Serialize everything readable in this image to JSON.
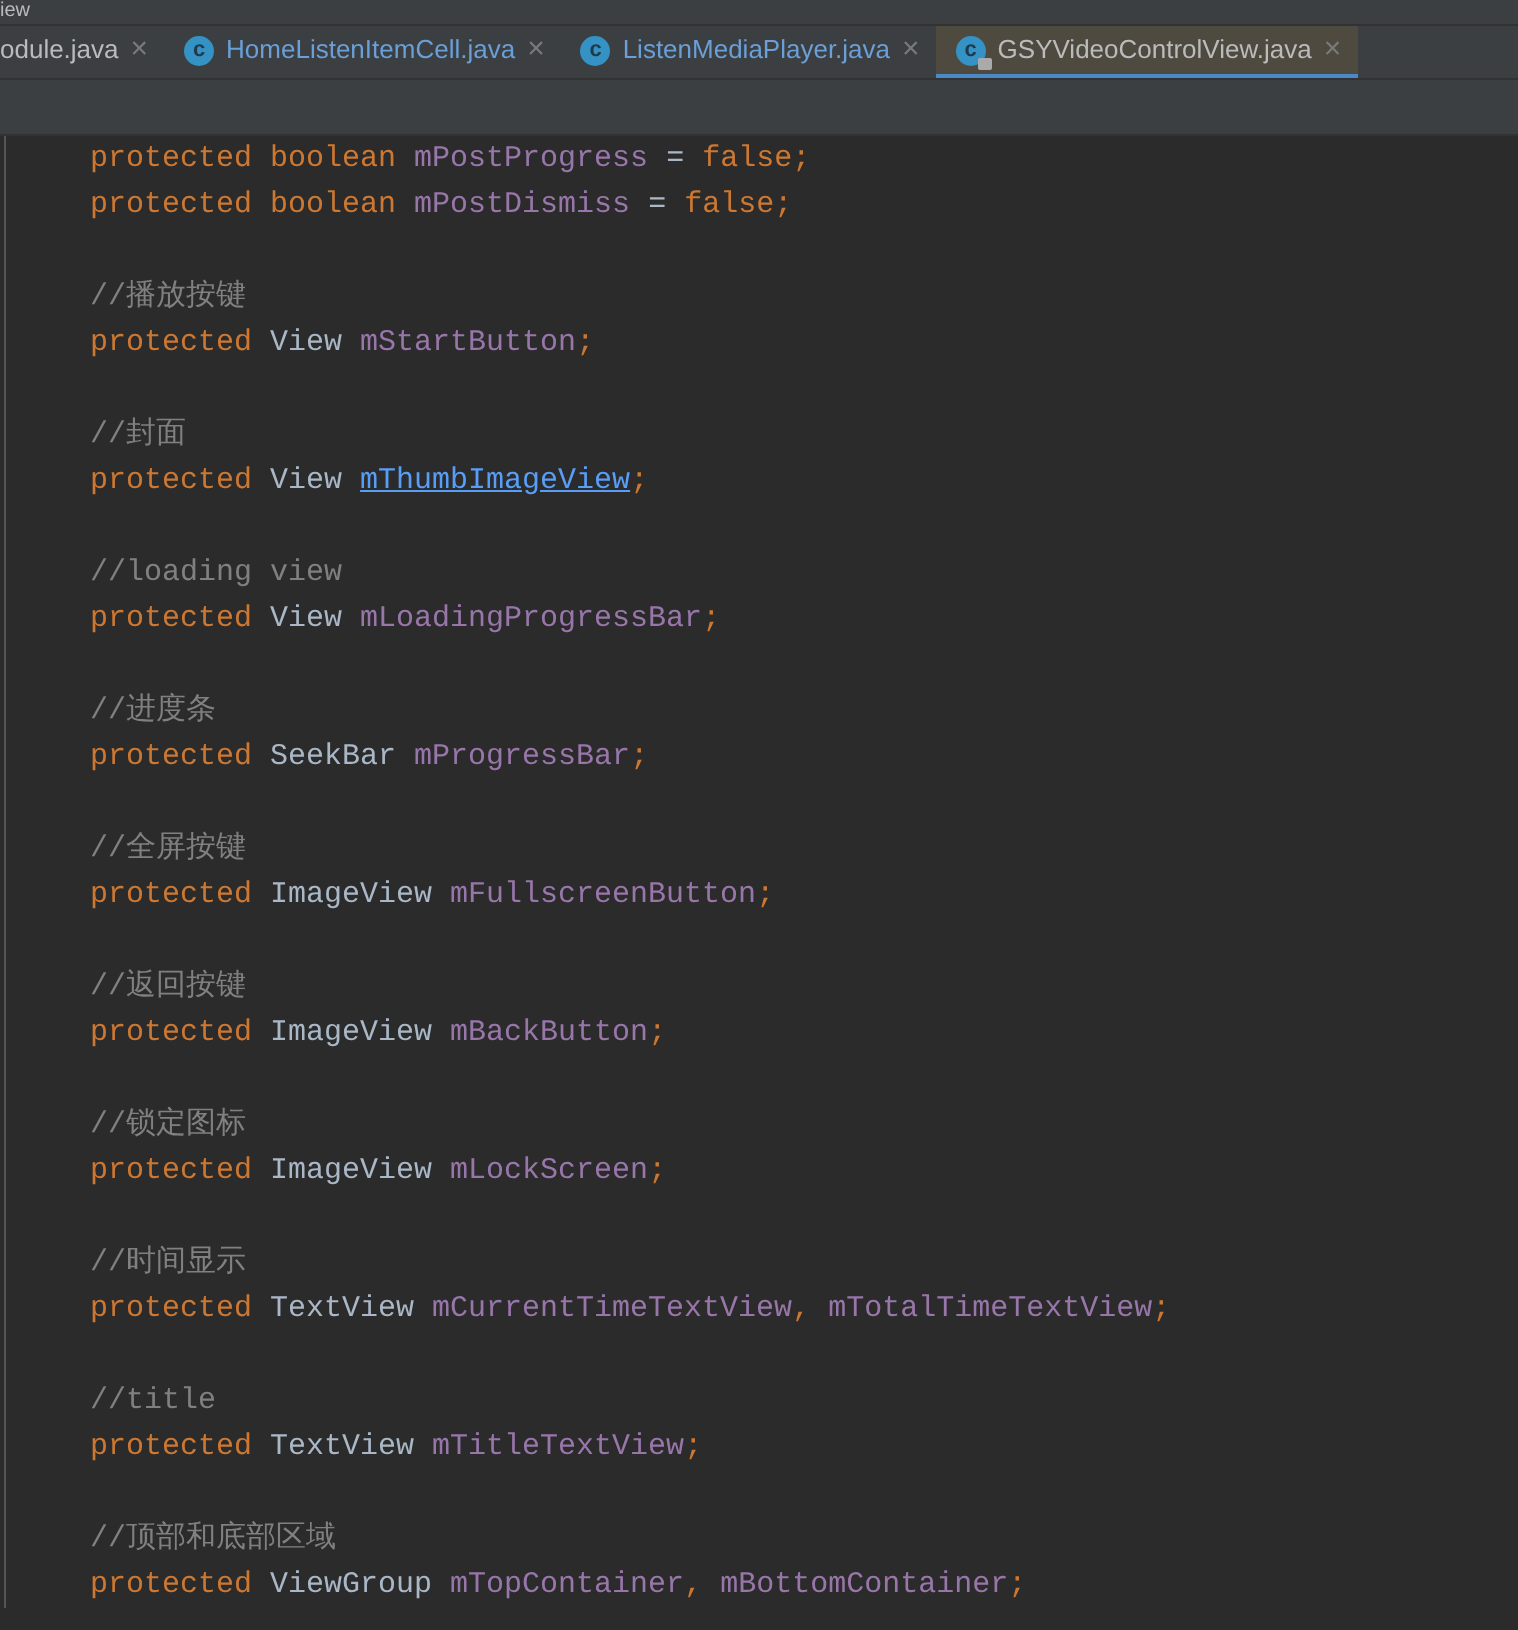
{
  "menu_fragment": "iew",
  "tabs": [
    {
      "label": "odule.java",
      "selected": false,
      "modified": false
    },
    {
      "label": "HomeListenItemCell.java",
      "selected": false,
      "modified": true,
      "icon_letter": "c"
    },
    {
      "label": "ListenMediaPlayer.java",
      "selected": false,
      "modified": true,
      "icon_letter": "c"
    },
    {
      "label": "GSYVideoControlView.java",
      "selected": true,
      "modified": false,
      "icon_letter": "c",
      "locked": true
    }
  ],
  "close_symbol": "×",
  "code_lines": [
    {
      "kind": "code",
      "tokens": [
        {
          "kind": "keyword",
          "text": "protected boolean "
        },
        {
          "kind": "field",
          "text": "mPostProgress"
        },
        {
          "kind": "plain",
          "text": " = "
        },
        {
          "kind": "keyword",
          "text": "false;"
        }
      ]
    },
    {
      "kind": "code",
      "tokens": [
        {
          "kind": "keyword",
          "text": "protected boolean "
        },
        {
          "kind": "field",
          "text": "mPostDismiss"
        },
        {
          "kind": "plain",
          "text": " = "
        },
        {
          "kind": "keyword",
          "text": "false;"
        }
      ]
    },
    {
      "kind": "blank"
    },
    {
      "kind": "comment",
      "text": "//播放按键"
    },
    {
      "kind": "code",
      "tokens": [
        {
          "kind": "keyword",
          "text": "protected "
        },
        {
          "kind": "plain",
          "text": "View "
        },
        {
          "kind": "field",
          "text": "mStartButton"
        },
        {
          "kind": "keyword",
          "text": ";"
        }
      ]
    },
    {
      "kind": "blank"
    },
    {
      "kind": "comment",
      "text": "//封面"
    },
    {
      "kind": "code",
      "tokens": [
        {
          "kind": "keyword",
          "text": "protected "
        },
        {
          "kind": "plain",
          "text": "View "
        },
        {
          "kind": "link",
          "text": "mThumbImageView"
        },
        {
          "kind": "keyword",
          "text": ";"
        }
      ]
    },
    {
      "kind": "blank"
    },
    {
      "kind": "comment",
      "text": "//loading view"
    },
    {
      "kind": "code",
      "tokens": [
        {
          "kind": "keyword",
          "text": "protected "
        },
        {
          "kind": "plain",
          "text": "View "
        },
        {
          "kind": "field",
          "text": "mLoadingProgressBar"
        },
        {
          "kind": "keyword",
          "text": ";"
        }
      ]
    },
    {
      "kind": "blank"
    },
    {
      "kind": "comment",
      "text": "//进度条"
    },
    {
      "kind": "code",
      "tokens": [
        {
          "kind": "keyword",
          "text": "protected "
        },
        {
          "kind": "plain",
          "text": "SeekBar "
        },
        {
          "kind": "field",
          "text": "mProgressBar"
        },
        {
          "kind": "keyword",
          "text": ";"
        }
      ]
    },
    {
      "kind": "blank"
    },
    {
      "kind": "comment",
      "text": "//全屏按键"
    },
    {
      "kind": "code",
      "tokens": [
        {
          "kind": "keyword",
          "text": "protected "
        },
        {
          "kind": "plain",
          "text": "ImageView "
        },
        {
          "kind": "field",
          "text": "mFullscreenButton"
        },
        {
          "kind": "keyword",
          "text": ";"
        }
      ]
    },
    {
      "kind": "blank"
    },
    {
      "kind": "comment",
      "text": "//返回按键"
    },
    {
      "kind": "code",
      "tokens": [
        {
          "kind": "keyword",
          "text": "protected "
        },
        {
          "kind": "plain",
          "text": "ImageView "
        },
        {
          "kind": "field",
          "text": "mBackButton"
        },
        {
          "kind": "keyword",
          "text": ";"
        }
      ]
    },
    {
      "kind": "blank"
    },
    {
      "kind": "comment",
      "text": "//锁定图标"
    },
    {
      "kind": "code",
      "tokens": [
        {
          "kind": "keyword",
          "text": "protected "
        },
        {
          "kind": "plain",
          "text": "ImageView "
        },
        {
          "kind": "field",
          "text": "mLockScreen"
        },
        {
          "kind": "keyword",
          "text": ";"
        }
      ]
    },
    {
      "kind": "blank"
    },
    {
      "kind": "comment",
      "text": "//时间显示"
    },
    {
      "kind": "code",
      "tokens": [
        {
          "kind": "keyword",
          "text": "protected "
        },
        {
          "kind": "plain",
          "text": "TextView "
        },
        {
          "kind": "field",
          "text": "mCurrentTimeTextView"
        },
        {
          "kind": "keyword",
          "text": ", "
        },
        {
          "kind": "field",
          "text": "mTotalTimeTextView"
        },
        {
          "kind": "keyword",
          "text": ";"
        }
      ]
    },
    {
      "kind": "blank"
    },
    {
      "kind": "comment",
      "text": "//title"
    },
    {
      "kind": "code",
      "tokens": [
        {
          "kind": "keyword",
          "text": "protected "
        },
        {
          "kind": "plain",
          "text": "TextView "
        },
        {
          "kind": "field",
          "text": "mTitleTextView"
        },
        {
          "kind": "keyword",
          "text": ";"
        }
      ]
    },
    {
      "kind": "blank"
    },
    {
      "kind": "comment",
      "text": "//顶部和底部区域"
    },
    {
      "kind": "code",
      "tokens": [
        {
          "kind": "keyword",
          "text": "protected "
        },
        {
          "kind": "plain",
          "text": "ViewGroup "
        },
        {
          "kind": "field",
          "text": "mTopContainer"
        },
        {
          "kind": "keyword",
          "text": ", "
        },
        {
          "kind": "field",
          "text": "mBottomContainer"
        },
        {
          "kind": "keyword",
          "text": ";"
        }
      ]
    }
  ]
}
